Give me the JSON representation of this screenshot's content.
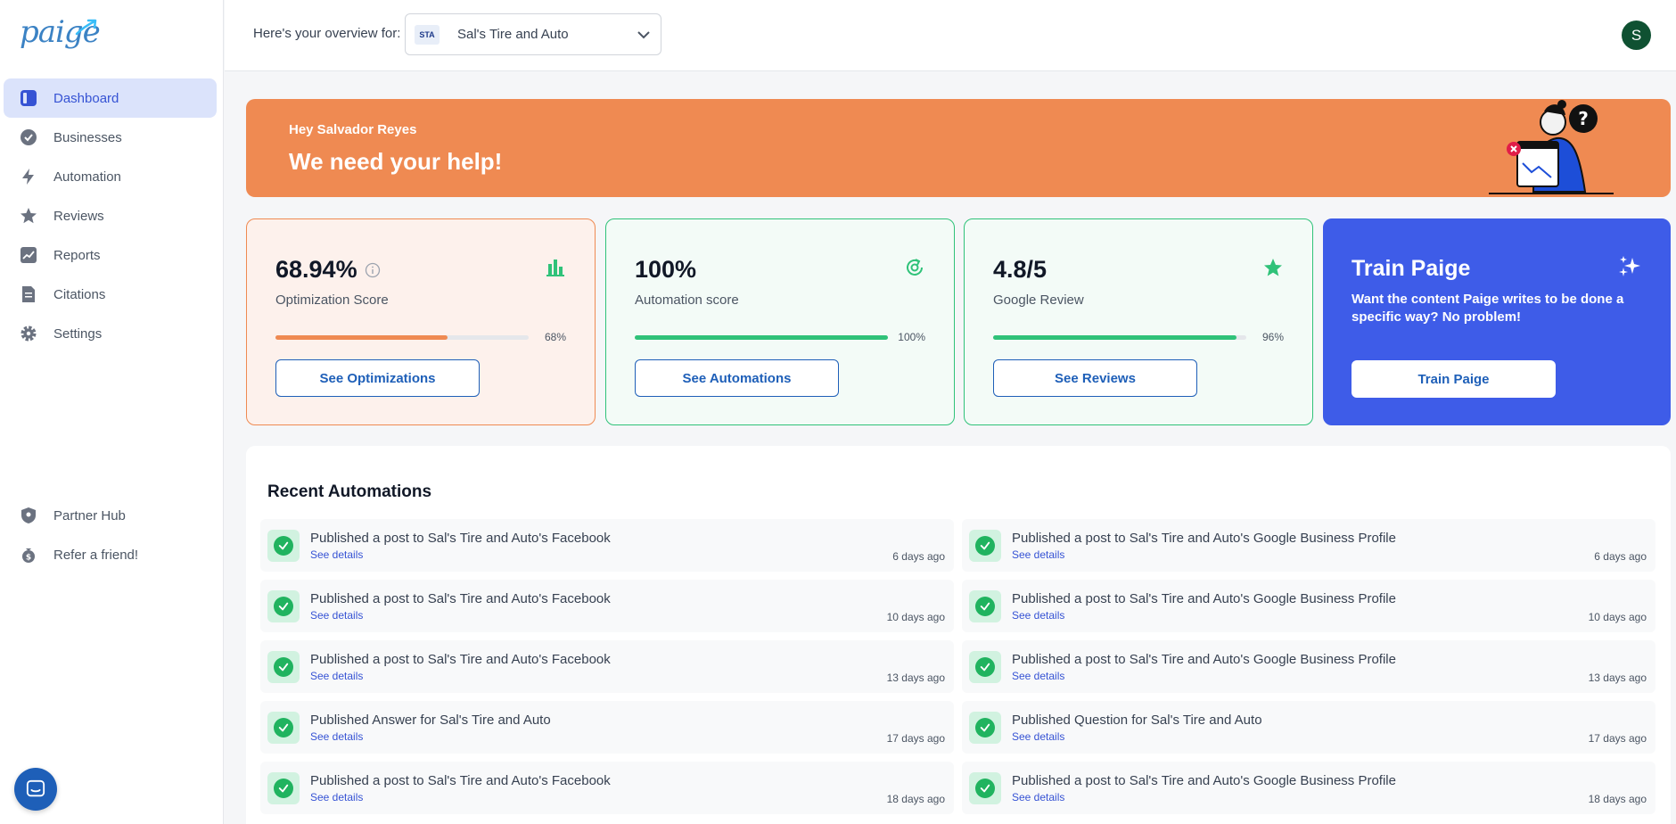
{
  "app": {
    "logo_text": "paige"
  },
  "sidebar": {
    "items": [
      {
        "label": "Dashboard",
        "icon": "dashboard-icon",
        "active": true
      },
      {
        "label": "Businesses",
        "icon": "badge-check-icon"
      },
      {
        "label": "Automation",
        "icon": "lightning-icon"
      },
      {
        "label": "Reviews",
        "icon": "star-icon"
      },
      {
        "label": "Reports",
        "icon": "chart-icon"
      },
      {
        "label": "Citations",
        "icon": "document-icon"
      },
      {
        "label": "Settings",
        "icon": "gear-icon"
      }
    ],
    "bottom_items": [
      {
        "label": "Partner Hub",
        "icon": "shield-icon"
      },
      {
        "label": "Refer a friend!",
        "icon": "money-bag-icon"
      }
    ]
  },
  "header": {
    "overview_label": "Here's your overview for:",
    "business_logo_text": "STA",
    "business_name": "Sal's Tire and Auto",
    "avatar_initial": "S"
  },
  "banner": {
    "greeting": "Hey Salvador Reyes",
    "title": "We need your help!"
  },
  "cards": {
    "optimization": {
      "value": "68.94%",
      "label": "Optimization Score",
      "percent_text": "68%",
      "progress": 0.68,
      "button": "See Optimizations",
      "color": "#ef8a52"
    },
    "automation": {
      "value": "100%",
      "label": "Automation score",
      "percent_text": "100%",
      "progress": 1.0,
      "button": "See Automations",
      "color": "#2fc279"
    },
    "review": {
      "value": "4.8/5",
      "label": "Google Review",
      "percent_text": "96%",
      "progress": 0.96,
      "button": "See Reviews",
      "color": "#2fc279"
    },
    "train": {
      "title": "Train Paige",
      "description": "Want the content Paige writes to be done a specific way? No problem!",
      "button": "Train Paige"
    }
  },
  "recent": {
    "title": "Recent Automations",
    "link_label": "See details",
    "left": [
      {
        "text": "Published a post to Sal's Tire and Auto's Facebook",
        "time": "6 days ago"
      },
      {
        "text": "Published a post to Sal's Tire and Auto's Facebook",
        "time": "10 days ago"
      },
      {
        "text": "Published a post to Sal's Tire and Auto's Facebook",
        "time": "13 days ago"
      },
      {
        "text": "Published Answer for Sal's Tire and Auto",
        "time": "17 days ago"
      },
      {
        "text": "Published a post to Sal's Tire and Auto's Facebook",
        "time": "18 days ago"
      }
    ],
    "right": [
      {
        "text": "Published a post to Sal's Tire and Auto's Google Business Profile",
        "time": "6 days ago"
      },
      {
        "text": "Published a post to Sal's Tire and Auto's Google Business Profile",
        "time": "10 days ago"
      },
      {
        "text": "Published a post to Sal's Tire and Auto's Google Business Profile",
        "time": "13 days ago"
      },
      {
        "text": "Published Question for Sal's Tire and Auto",
        "time": "17 days ago"
      },
      {
        "text": "Published a post to Sal's Tire and Auto's Google Business Profile",
        "time": "18 days ago"
      }
    ]
  }
}
